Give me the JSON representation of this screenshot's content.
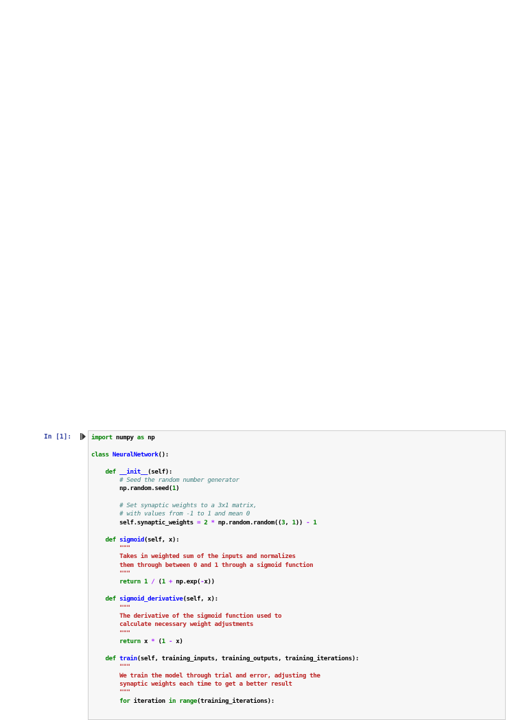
{
  "cell": {
    "prompt": "In [1]:",
    "run_icon": "run-cell-icon",
    "lines": [
      [
        [
          "import",
          "kw"
        ],
        [
          " numpy ",
          "tx"
        ],
        [
          "as",
          "kw"
        ],
        [
          " np",
          "tx"
        ]
      ],
      [],
      [
        [
          "class",
          "kw"
        ],
        [
          " ",
          "tx"
        ],
        [
          "NeuralNetwork",
          "nm"
        ],
        [
          "():",
          "tx"
        ]
      ],
      [],
      [
        [
          "    ",
          "tx"
        ],
        [
          "def",
          "kw"
        ],
        [
          " ",
          "tx"
        ],
        [
          "__init__",
          "nm"
        ],
        [
          "(self):",
          "tx"
        ]
      ],
      [
        [
          "        ",
          "tx"
        ],
        [
          "# Seed the random number generator",
          "cm"
        ]
      ],
      [
        [
          "        np.random.seed(",
          "tx"
        ],
        [
          "1",
          "nu"
        ],
        [
          ")",
          "tx"
        ]
      ],
      [],
      [
        [
          "        ",
          "tx"
        ],
        [
          "# Set synaptic weights to a 3x1 matrix,",
          "cm"
        ]
      ],
      [
        [
          "        ",
          "tx"
        ],
        [
          "# with values from -1 to 1 and mean 0",
          "cm"
        ]
      ],
      [
        [
          "        self.synaptic_weights ",
          "tx"
        ],
        [
          "=",
          "op"
        ],
        [
          " ",
          "tx"
        ],
        [
          "2",
          "nu"
        ],
        [
          " ",
          "tx"
        ],
        [
          "*",
          "op"
        ],
        [
          " np.random.random((",
          "tx"
        ],
        [
          "3",
          "nu"
        ],
        [
          ", ",
          "tx"
        ],
        [
          "1",
          "nu"
        ],
        [
          ")) ",
          "tx"
        ],
        [
          "-",
          "op"
        ],
        [
          " ",
          "tx"
        ],
        [
          "1",
          "nu"
        ]
      ],
      [],
      [
        [
          "    ",
          "tx"
        ],
        [
          "def",
          "kw"
        ],
        [
          " ",
          "tx"
        ],
        [
          "sigmoid",
          "nm"
        ],
        [
          "(self, x):",
          "tx"
        ]
      ],
      [
        [
          "        ",
          "tx"
        ],
        [
          "\"\"\"",
          "st"
        ]
      ],
      [
        [
          "        ",
          "tx"
        ],
        [
          "Takes in weighted sum of the inputs and normalizes",
          "st"
        ]
      ],
      [
        [
          "        ",
          "tx"
        ],
        [
          "them through between 0 and 1 through a sigmoid function",
          "st"
        ]
      ],
      [
        [
          "        ",
          "tx"
        ],
        [
          "\"\"\"",
          "st"
        ]
      ],
      [
        [
          "        ",
          "tx"
        ],
        [
          "return",
          "kw"
        ],
        [
          " ",
          "tx"
        ],
        [
          "1",
          "nu"
        ],
        [
          " ",
          "tx"
        ],
        [
          "/",
          "op"
        ],
        [
          " (",
          "tx"
        ],
        [
          "1",
          "nu"
        ],
        [
          " ",
          "tx"
        ],
        [
          "+",
          "op"
        ],
        [
          " np.exp(",
          "tx"
        ],
        [
          "-",
          "op"
        ],
        [
          "x))",
          "tx"
        ]
      ],
      [],
      [
        [
          "    ",
          "tx"
        ],
        [
          "def",
          "kw"
        ],
        [
          " ",
          "tx"
        ],
        [
          "sigmoid_derivative",
          "nm"
        ],
        [
          "(self, x):",
          "tx"
        ]
      ],
      [
        [
          "        ",
          "tx"
        ],
        [
          "\"\"\"",
          "st"
        ]
      ],
      [
        [
          "        ",
          "tx"
        ],
        [
          "The derivative of the sigmoid function used to",
          "st"
        ]
      ],
      [
        [
          "        ",
          "tx"
        ],
        [
          "calculate necessary weight adjustments",
          "st"
        ]
      ],
      [
        [
          "        ",
          "tx"
        ],
        [
          "\"\"\"",
          "st"
        ]
      ],
      [
        [
          "        ",
          "tx"
        ],
        [
          "return",
          "kw"
        ],
        [
          " x ",
          "tx"
        ],
        [
          "*",
          "op"
        ],
        [
          " (",
          "tx"
        ],
        [
          "1",
          "nu"
        ],
        [
          " ",
          "tx"
        ],
        [
          "-",
          "op"
        ],
        [
          " x)",
          "tx"
        ]
      ],
      [],
      [
        [
          "    ",
          "tx"
        ],
        [
          "def",
          "kw"
        ],
        [
          " ",
          "tx"
        ],
        [
          "train",
          "nm"
        ],
        [
          "(self, training_inputs, training_outputs, training_iterations):",
          "tx"
        ]
      ],
      [
        [
          "        ",
          "tx"
        ],
        [
          "\"\"\"",
          "st"
        ]
      ],
      [
        [
          "        ",
          "tx"
        ],
        [
          "We train the model through trial and error, adjusting the",
          "st"
        ]
      ],
      [
        [
          "        ",
          "tx"
        ],
        [
          "synaptic weights each time to get a better result",
          "st"
        ]
      ],
      [
        [
          "        ",
          "tx"
        ],
        [
          "\"\"\"",
          "st"
        ]
      ],
      [
        [
          "        ",
          "tx"
        ],
        [
          "for",
          "kw"
        ],
        [
          " iteration ",
          "tx"
        ],
        [
          "in",
          "kw"
        ],
        [
          " ",
          "tx"
        ],
        [
          "range",
          "kw"
        ],
        [
          "(training_iterations):",
          "tx"
        ]
      ]
    ]
  }
}
